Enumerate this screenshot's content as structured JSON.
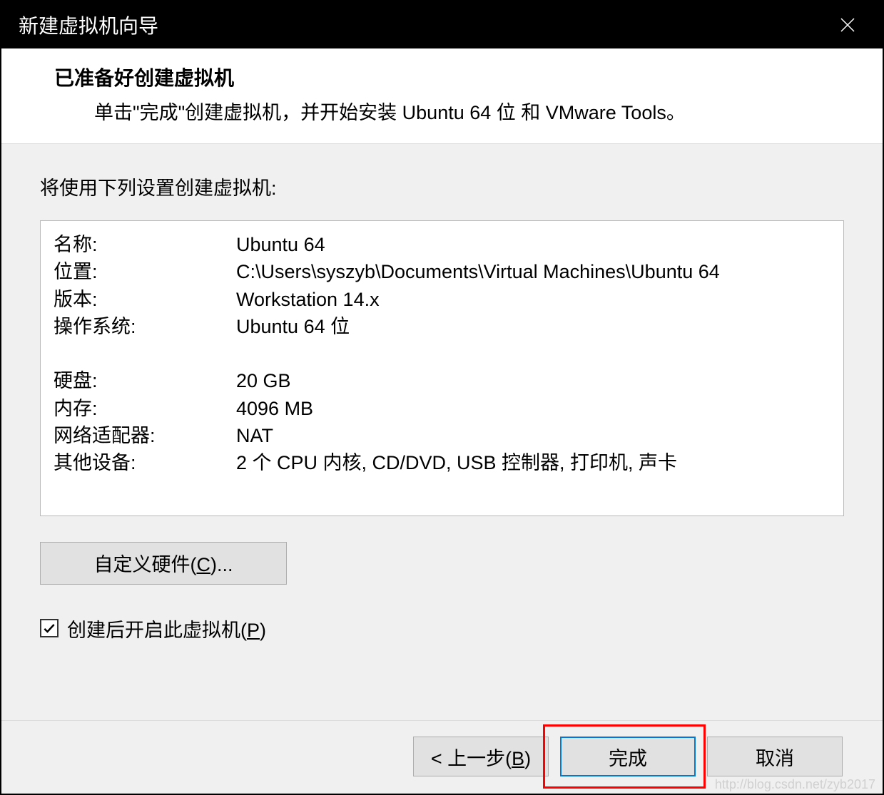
{
  "titlebar": {
    "title": "新建虚拟机向导"
  },
  "header": {
    "title": "已准备好创建虚拟机",
    "subtitle": "单击\"完成\"创建虚拟机，并开始安装 Ubuntu 64 位 和 VMware Tools。"
  },
  "content": {
    "intro": "将使用下列设置创建虚拟机:",
    "settings": {
      "name_label": "名称:",
      "name_value": "Ubuntu 64",
      "location_label": "位置:",
      "location_value": "C:\\Users\\syszyb\\Documents\\Virtual Machines\\Ubuntu 64",
      "version_label": "版本:",
      "version_value": "Workstation 14.x",
      "os_label": "操作系统:",
      "os_value": "Ubuntu 64 位",
      "disk_label": "硬盘:",
      "disk_value": "20 GB",
      "memory_label": "内存:",
      "memory_value": "4096 MB",
      "network_label": "网络适配器:",
      "network_value": "NAT",
      "other_label": "其他设备:",
      "other_value": "2 个 CPU 内核, CD/DVD, USB 控制器, 打印机, 声卡"
    },
    "customize_prefix": "自定义硬件(",
    "customize_key": "C",
    "customize_suffix": ")...",
    "poweron_prefix": "创建后开启此虚拟机(",
    "poweron_key": "P",
    "poweron_suffix": ")"
  },
  "footer": {
    "back_prefix": "< 上一步(",
    "back_key": "B",
    "back_suffix": ")",
    "finish": "完成",
    "cancel": "取消"
  },
  "watermark": "http://blog.csdn.net/zyb2017"
}
